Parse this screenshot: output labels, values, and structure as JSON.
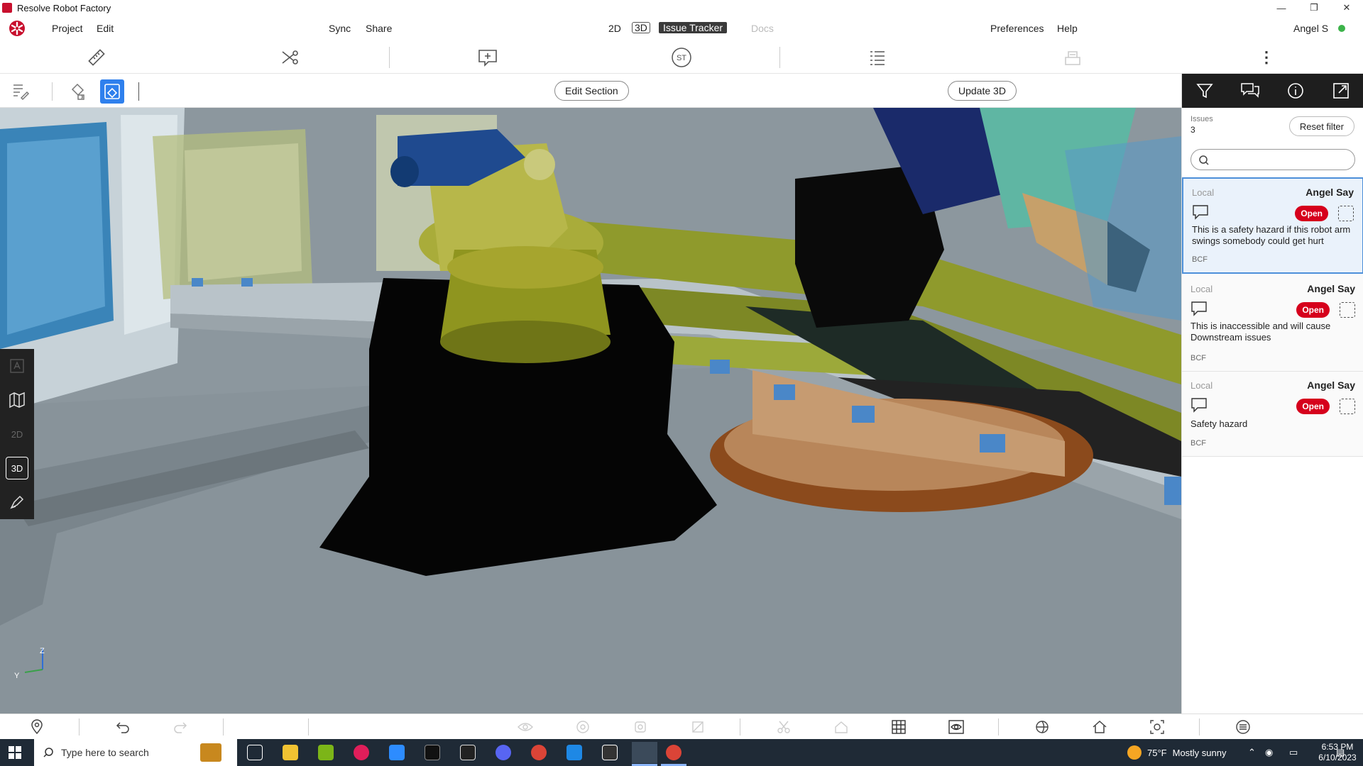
{
  "window": {
    "title": "Resolve Robot Factory",
    "minimize": "—",
    "restore": "❐",
    "close": "✕"
  },
  "menu": {
    "project": "Project",
    "edit": "Edit",
    "sync": "Sync",
    "share": "Share",
    "mode_2d": "2D",
    "mode_3d": "3D",
    "issue_tracker": "Issue Tracker",
    "docs": "Docs",
    "preferences": "Preferences",
    "help": "Help",
    "user": "Angel S"
  },
  "toolbar": {
    "more": "⋮",
    "st_label": "ST"
  },
  "subbar": {
    "edit_section": "Edit Section",
    "update_3d": "Update 3D"
  },
  "side_tools": {
    "mode_2d": "2D",
    "mode_3d": "3D"
  },
  "axes": {
    "z": "Z",
    "y": "Y"
  },
  "panel": {
    "issues_label": "Issues",
    "issues_count": "3",
    "reset_filter": "Reset filter",
    "search_placeholder": "",
    "issues": [
      {
        "source": "Local",
        "author": "Angel Say",
        "status": "Open",
        "text": "This is a safety hazard if this robot arm swings somebody could get hurt",
        "type": "BCF"
      },
      {
        "source": "Local",
        "author": "Angel Say",
        "status": "Open",
        "text": "This is inaccessible and will cause Downstream issues",
        "type": "BCF"
      },
      {
        "source": "Local",
        "author": "Angel Say",
        "status": "Open",
        "text": "Safety hazard",
        "type": "BCF"
      }
    ]
  },
  "taskbar": {
    "search_placeholder": "Type here to search",
    "temperature": "75°F",
    "weather": "Mostly sunny",
    "time": "6:53 PM",
    "date": "6/10/2023"
  },
  "colors": {
    "accent": "#2f80ed",
    "open_status": "#d6001c",
    "online": "#3cb34a",
    "selected_border": "#4c8fd9"
  }
}
